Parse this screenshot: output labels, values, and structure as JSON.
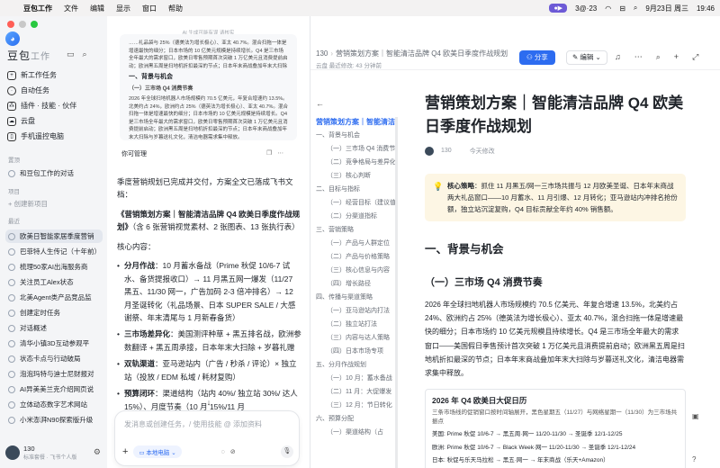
{
  "menubar": {
    "apple": "",
    "app": "豆包工作",
    "items": [
      "文件",
      "编辑",
      "显示",
      "窗口",
      "帮助"
    ],
    "time_badge": "3@·23",
    "date": "9月23日 周三",
    "clock": "19:46"
  },
  "sidebar": {
    "brand": "豆包",
    "brand_sub": "工作",
    "nav": [
      {
        "label": "新工作任务",
        "icon": "new-task-icon"
      },
      {
        "label": "自动任务",
        "icon": "clock-icon"
      },
      {
        "label": "插件 · 技能 · 伙伴",
        "icon": "plugin-icon"
      },
      {
        "label": "云盘",
        "icon": "cloud-icon"
      },
      {
        "label": "手机遥控电脑",
        "icon": "phone-icon"
      }
    ],
    "section_pinned": "置顶",
    "pinned_item": "和豆包工作的对话",
    "section_projects": "项目",
    "new_project": "+ 创建新项目",
    "section_recent": "最近",
    "recent": [
      "欧美日智能家居季度营销",
      "巴菲特人生传记（十年前）",
      "梳理50家AI出海服务商",
      "关注员工Alex状态",
      "北美Agent类产品竞品监",
      "创建定时任务",
      "对话概述",
      "清华小镇3D互动参观平",
      "状态卡点与行动破局",
      "泡泡玛特与迪士尼财报对",
      "AI异美美兰克介绍网页说",
      "立体动态数字艺术网站",
      "小米澎湃N90探索版升级"
    ],
    "user": {
      "name": "130",
      "sub": "标准套餐 · 飞书个人版"
    }
  },
  "chat": {
    "hint": "AI 生成可能有误 请核实",
    "thumb_intro": "……礼品袋与 25%（德美法为增长极心）、亚太 40.7%。混合扫拖一体是增速最快的细分；日本市场的 10 亿美元规模是持续增长。Q4 是三市场全年最大的需求窗口，欧美日零售预期首次突破 1 万亿美元且消费提前启动；欧洲黑五周是扫地机折扣最深的节点；日本年末商战叠加年末大扫除与岁暮送礼文化，清洁电器需求集中释放。",
    "thumb_h": "一、背景与机会",
    "thumb_s": "（一）三市场 Q4 消费节奏",
    "thumb_text": "2026 年全球扫地机器人市场规模约 70.5 亿美元，年复合增速约 13.5%。北美约占 24%，欧洲约占 25%（德英法为增长极心）、亚太 40.7%。混合扫拖一体是增速最快的细分；日本市场的 10 亿美元规模是持续增长。Q4 是三市场全年最大的需求窗口，欧美日零售预期首次突破 1 万亿美元且消费提前启动；欧洲黑五周是扫地机折扣最深的节点；日本年末商战叠加年末大扫除与岁暮送礼文化，清洁电器需求集中释放。",
    "tag": "你可管理",
    "msg_intro": "季度营销规划已完成并交付，方案全文已落成飞书文档：",
    "msg_doc": "《营销策划方案｜智能清洁品牌 Q4 欧美日季度作战规划》",
    "msg_doc_tail": "（含 6 张营销视觉素材、2 张图表、13 张执行表）",
    "core_label": "核心内容：",
    "bullets": [
      {
        "k": "分月作战",
        "v": "：10 月蓄水备战（Prime 秋促 10/6-7 试水、备货提报收口）→ 11 月黑五网一爆发（11/27 黑五、11/30 网一，广告加码 2-3 倍冲排名）→ 12 月圣诞转化（礼品场景、日本 SUPER SALE / 大感谢祭、年末清尾与 1 月新春备货）"
      },
      {
        "k": "三市场差异化",
        "v": "：美国测评种草 + 黑五排名战，欧洲参数翻译 + 黑五周承接，日本年末大扫除 + 岁暮礼赠"
      },
      {
        "k": "双轨渠道",
        "v": "：亚马逊站内（广告 / 秒杀 / 评论）× 独立站（投放 / EDM 私域 / 耗材复购）"
      },
      {
        "k": "预算闭环",
        "v": "：渠道结构（站内 40%/ 独立站 30%/ 达人 15%）、月度节奏（10 月 15%/11 月"
      }
    ],
    "composer_placeholder": "发消息或创建任务，/ 使用技能 @ 添加资料",
    "chip": "本地电脑"
  },
  "doc": {
    "crumb": [
      "130",
      "营销策划方案｜智能清洁品牌 Q4 欧美日季度作战规划"
    ],
    "saved": "云盘    最近修改: 43 分钟前",
    "share": "分享",
    "edit": "编辑",
    "outline_current": "营销策划方案｜智能清洁品牌 Q4 欧美日季度作战规划",
    "outline": [
      {
        "t": "一、背景与机会",
        "lv": 1
      },
      {
        "t": "（一）三市场 Q4 消费节奏",
        "lv": 2
      },
      {
        "t": "（二）竞争格局与差异化",
        "lv": 2
      },
      {
        "t": "（三）核心判断",
        "lv": 2
      },
      {
        "t": "二、目标与指标",
        "lv": 1
      },
      {
        "t": "（一）经营目标（建议值）",
        "lv": 2
      },
      {
        "t": "（二）分渠道指标",
        "lv": 2
      },
      {
        "t": "三、营销策略",
        "lv": 1
      },
      {
        "t": "（一）产品与人群定位",
        "lv": 2
      },
      {
        "t": "（二）产品与价格策略",
        "lv": 2
      },
      {
        "t": "（三）核心信息与内容",
        "lv": 2
      },
      {
        "t": "（四）增长路径",
        "lv": 2
      },
      {
        "t": "四、传播与渠道策略",
        "lv": 1
      },
      {
        "t": "（一）亚马逊站内打法",
        "lv": 2
      },
      {
        "t": "（二）独立站打法",
        "lv": 2
      },
      {
        "t": "（三）内容与达人策略",
        "lv": 2
      },
      {
        "t": "（四）日本市场专项",
        "lv": 2
      },
      {
        "t": "五、分月作战规划",
        "lv": 1
      },
      {
        "t": "（一）10 月：蓄水备战",
        "lv": 2
      },
      {
        "t": "（二）11 月：大促爆发",
        "lv": 2
      },
      {
        "t": "（三）12 月：节日转化",
        "lv": 2
      },
      {
        "t": "六、预算分配",
        "lv": 1
      },
      {
        "t": "（一）渠道结构（占",
        "lv": 2
      }
    ],
    "title": "营销策划方案｜智能清洁品牌 Q4 欧美日季度作战规划",
    "author": "130",
    "date": "今天修改",
    "callout_label": "核心策略",
    "callout": "：抓住 11 月黑五/网一三市场共振与 12 月欧美圣诞、日本年末商战两大礼品窗口——10 月蓄水、11 月引爆、12 月转化；亚马逊站内冲排名抢份额，独立站沉淀复购，Q4 目标贡献全年约 40% 销售额。",
    "h1": "一、背景与机会",
    "h2": "（一）三市场 Q4 消费节奏",
    "para": "2026 年全球扫地机器人市场规模约 70.5 亿美元、年复合增速 13.5%，北美约占 24%、欧洲约占 25%（德英法为增长极心）、亚太 40.7%，混合扫拖一体是增速最快的细分；日本市场约 10 亿美元规模且持续增长。Q4 是三市场全年最大的需求窗口——美国假日季售预计首次突破 1 万亿美元且消费提前启动；欧洲黑五周是扫地机折扣最深的节点；日本年末商战叠加年末大扫除与岁暮送礼文化，清洁电器需求集中释放。",
    "card_title": "2026 年 Q4 欧美日大促日历",
    "card_sub": "三条市场线的促销窗口按时间轴展开，黑色星期五（11/27）与网络星期一（11/30）为三市场共振点",
    "card_rows": [
      "美国: Prime 秋促 10/6-7 → 黑五周·网一 11/20-11/30 → 圣诞季 12/1-12/25",
      "欧洲: Prime 秋促 10/6-7 → Black Week·网一 11/20-11/30 → 圣诞季 12/1-12/24",
      "日本: 秋促与乐天马拉松 → 黑五·网一 → 年末商战（乐天+Amazon）"
    ]
  }
}
